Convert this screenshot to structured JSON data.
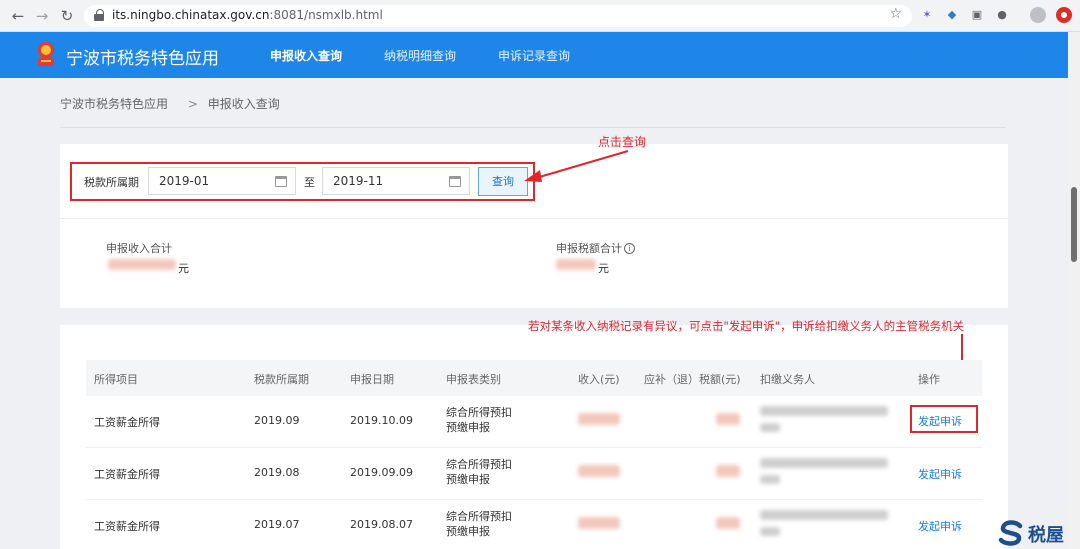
{
  "browser": {
    "url_host": "its.ningbo.chinatax.gov.cn",
    "url_rest": ":8081/nsmxlb.html",
    "back_icon": "←",
    "forward_icon": "→",
    "reload_icon": "↻",
    "star_icon": "☆",
    "menu_icon": "⋮"
  },
  "header": {
    "title": "宁波市税务特色应用",
    "tabs": [
      {
        "label": "申报收入查询",
        "active": true
      },
      {
        "label": "纳税明细查询",
        "active": false
      },
      {
        "label": "申诉记录查询",
        "active": false
      }
    ]
  },
  "breadcrumb": {
    "root": "宁波市税务特色应用",
    "sep": ">",
    "current": "申报收入查询"
  },
  "filter": {
    "label": "税款所属期",
    "from": "2019-01",
    "to_label": "至",
    "to": "2019-11",
    "query_button": "查询"
  },
  "annotations": {
    "click_query": "点击查询",
    "appeal_hint": "若对某条收入纳税记录有异议，可点击\"发起申诉\"，申诉给扣缴义务人的主管税务机关"
  },
  "summary": {
    "income_label": "申报收入合计",
    "income_unit": "元",
    "tax_label": "申报税额合计",
    "tax_info_icon": "i",
    "tax_unit": "元"
  },
  "table": {
    "headers": [
      "所得项目",
      "税款所属期",
      "申报日期",
      "申报表类别",
      "收入(元)",
      "应补（退）税额(元)",
      "扣缴义务人",
      "操作"
    ],
    "rows": [
      {
        "item": "工资薪金所得",
        "period": "2019.09",
        "date": "2019.10.09",
        "type_line1": "综合所得预扣",
        "type_line2": "预缴申报",
        "action": "发起申诉"
      },
      {
        "item": "工资薪金所得",
        "period": "2019.08",
        "date": "2019.09.09",
        "type_line1": "综合所得预扣",
        "type_line2": "预缴申报",
        "action": "发起申诉"
      },
      {
        "item": "工资薪金所得",
        "period": "2019.07",
        "date": "2019.08.07",
        "type_line1": "综合所得预扣",
        "type_line2": "预缴申报",
        "action": "发起申诉"
      }
    ]
  },
  "watermark": {
    "text": "税屋"
  },
  "colors": {
    "header_bg": "#1e86e8",
    "annotation_red": "#e0262d",
    "link_blue": "#1a7fd6"
  }
}
